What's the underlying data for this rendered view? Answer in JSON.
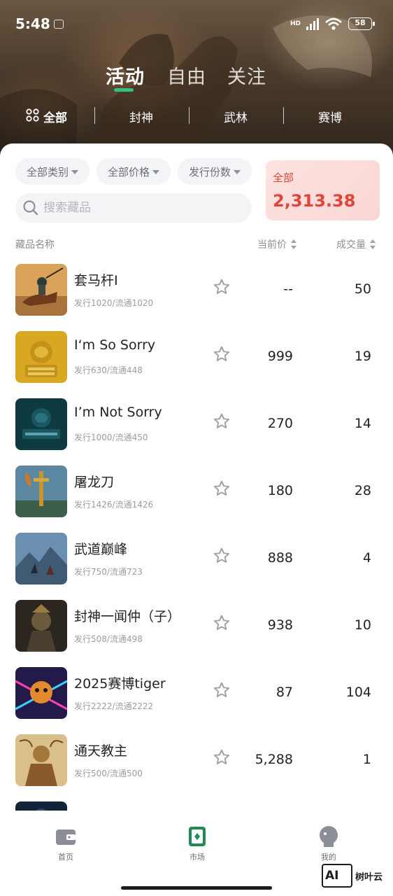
{
  "status_bar": {
    "time": "5:48",
    "network": "HD",
    "battery": "58"
  },
  "top_tabs": [
    {
      "label": "活动",
      "active": true
    },
    {
      "label": "自由",
      "active": false
    },
    {
      "label": "关注",
      "active": false
    }
  ],
  "categories": [
    {
      "label": "全部",
      "active": true,
      "icon": "grid-icon"
    },
    {
      "label": "封神",
      "active": false
    },
    {
      "label": "武林",
      "active": false
    },
    {
      "label": "赛博",
      "active": false
    }
  ],
  "filters": {
    "category": "全部类别",
    "price": "全部价格",
    "issue": "发行份数"
  },
  "search": {
    "placeholder": "搜索藏品"
  },
  "summary": {
    "label": "全部",
    "value": "2,313.38"
  },
  "columns": {
    "name": "藏品名称",
    "price": "当前价",
    "volume": "成交量"
  },
  "items": [
    {
      "name": "套马杆I",
      "meta": "发行1020/流通1020",
      "price": "--",
      "volume": "50",
      "thumb": "horse-rider"
    },
    {
      "name": "I‘m So Sorry",
      "meta": "发行630/流通448",
      "price": "999",
      "volume": "19",
      "thumb": "gold-elephant"
    },
    {
      "name": "I’m Not Sorry",
      "meta": "发行1000/流通450",
      "price": "270",
      "volume": "14",
      "thumb": "teal-elephant"
    },
    {
      "name": "屠龙刀",
      "meta": "发行1426/流通1426",
      "price": "180",
      "volume": "28",
      "thumb": "dragon-sword"
    },
    {
      "name": "武道巅峰",
      "meta": "发行750/流通723",
      "price": "888",
      "volume": "4",
      "thumb": "martial-peak"
    },
    {
      "name": "封神一闻仲（子）",
      "meta": "发行508/流通498",
      "price": "938",
      "volume": "10",
      "thumb": "dark-warrior"
    },
    {
      "name": "2025赛博tiger",
      "meta": "发行2222/流通2222",
      "price": "87",
      "volume": "104",
      "thumb": "cyber-tiger"
    },
    {
      "name": "通天教主",
      "meta": "发行500/流通500",
      "price": "5,288",
      "volume": "1",
      "thumb": "golden-deity"
    }
  ],
  "bottom_nav": [
    {
      "label": "首页",
      "icon": "wallet-icon",
      "active": false
    },
    {
      "label": "市场",
      "icon": "market-icon",
      "active": true
    },
    {
      "label": "我的",
      "icon": "profile-icon",
      "active": false
    }
  ],
  "watermark": {
    "logo": "AI",
    "text": "树叶云"
  },
  "colors": {
    "accent": "#2fc37b",
    "price_red": "#e0443a",
    "text_dark": "#1f2226",
    "text_muted": "#9a9da3"
  }
}
